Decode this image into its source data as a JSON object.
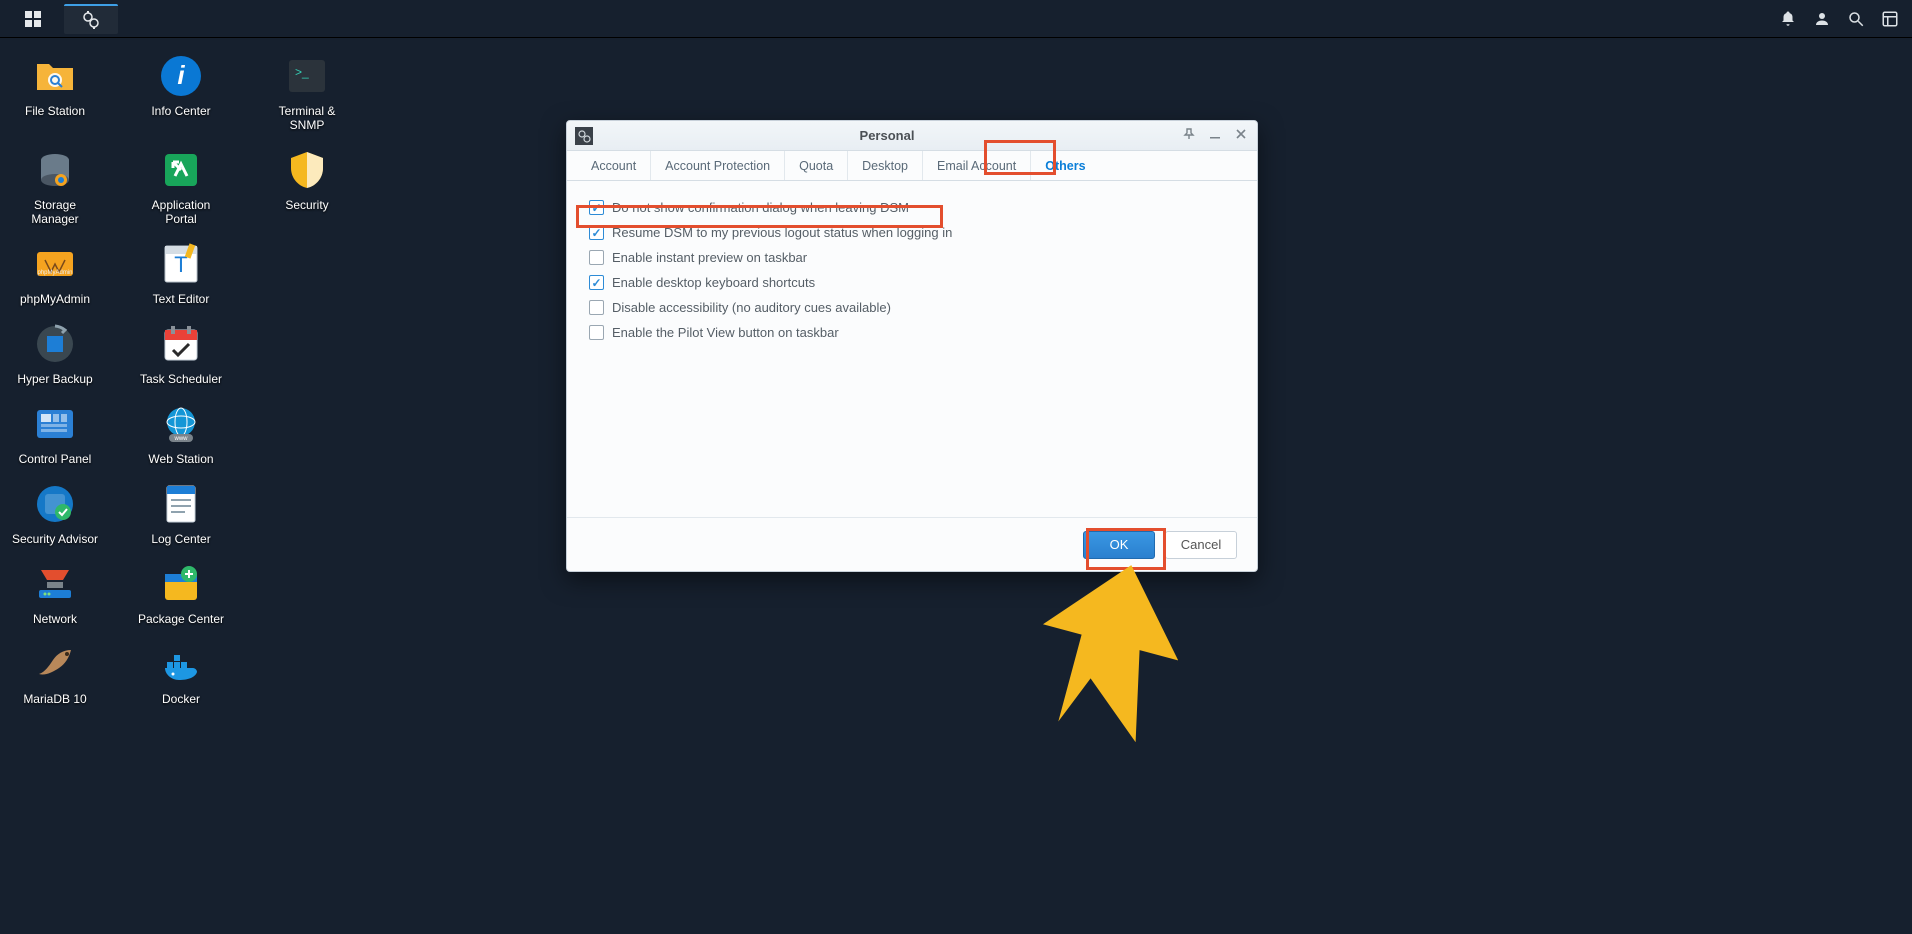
{
  "window": {
    "title": "Personal",
    "tabs": [
      "Account",
      "Account Protection",
      "Quota",
      "Desktop",
      "Email Account",
      "Others"
    ],
    "active_tab_index": 5,
    "checks": [
      {
        "label": "Do not show confirmation dialog when leaving DSM",
        "checked": true
      },
      {
        "label": "Resume DSM to my previous logout status when logging in",
        "checked": true
      },
      {
        "label": "Enable instant preview on taskbar",
        "checked": false
      },
      {
        "label": "Enable desktop keyboard shortcuts",
        "checked": true
      },
      {
        "label": "Disable accessibility (no auditory cues available)",
        "checked": false
      },
      {
        "label": "Enable the Pilot View button on taskbar",
        "checked": false
      }
    ],
    "buttons": {
      "ok": "OK",
      "cancel": "Cancel"
    }
  },
  "desktop_icons": [
    [
      {
        "name": "File Station",
        "color": "#f6b43a",
        "svg": "folder"
      },
      {
        "name": "Info Center",
        "color": "#0a78d4",
        "svg": "info"
      },
      {
        "name": "Terminal & SNMP",
        "color": "#2b333b",
        "svg": "terminal"
      }
    ],
    [
      {
        "name": "Storage Manager",
        "color": "#4a5663",
        "svg": "storage"
      },
      {
        "name": "Application Portal",
        "color": "#18a55a",
        "svg": "portal"
      },
      {
        "name": "Security",
        "color": "#f5b81f",
        "svg": "shield"
      }
    ],
    [
      {
        "name": "phpMyAdmin",
        "color": "#2b2b2b",
        "svg": "php"
      },
      {
        "name": "Text Editor",
        "color": "#e7edf1",
        "svg": "texteditor"
      }
    ],
    [
      {
        "name": "Hyper Backup",
        "color": "#2b414d",
        "svg": "backup"
      },
      {
        "name": "Task Scheduler",
        "color": "#ea4138",
        "svg": "calendar"
      }
    ],
    [
      {
        "name": "Control Panel",
        "color": "#2b80d5",
        "svg": "panel"
      },
      {
        "name": "Web Station",
        "color": "#1496d6",
        "svg": "globe"
      }
    ],
    [
      {
        "name": "Security Advisor",
        "color": "#1578c7",
        "svg": "secadvisor"
      },
      {
        "name": "Log Center",
        "color": "#1d7ed6",
        "svg": "log"
      }
    ],
    [
      {
        "name": "Network",
        "color": "#2b414d",
        "svg": "network"
      },
      {
        "name": "Package Center",
        "color": "#f5b81f",
        "svg": "package"
      }
    ],
    [
      {
        "name": "MariaDB 10",
        "color": "#2b2b2b",
        "svg": "maria"
      },
      {
        "name": "Docker",
        "color": "#2b2b2b",
        "svg": "docker"
      }
    ]
  ]
}
